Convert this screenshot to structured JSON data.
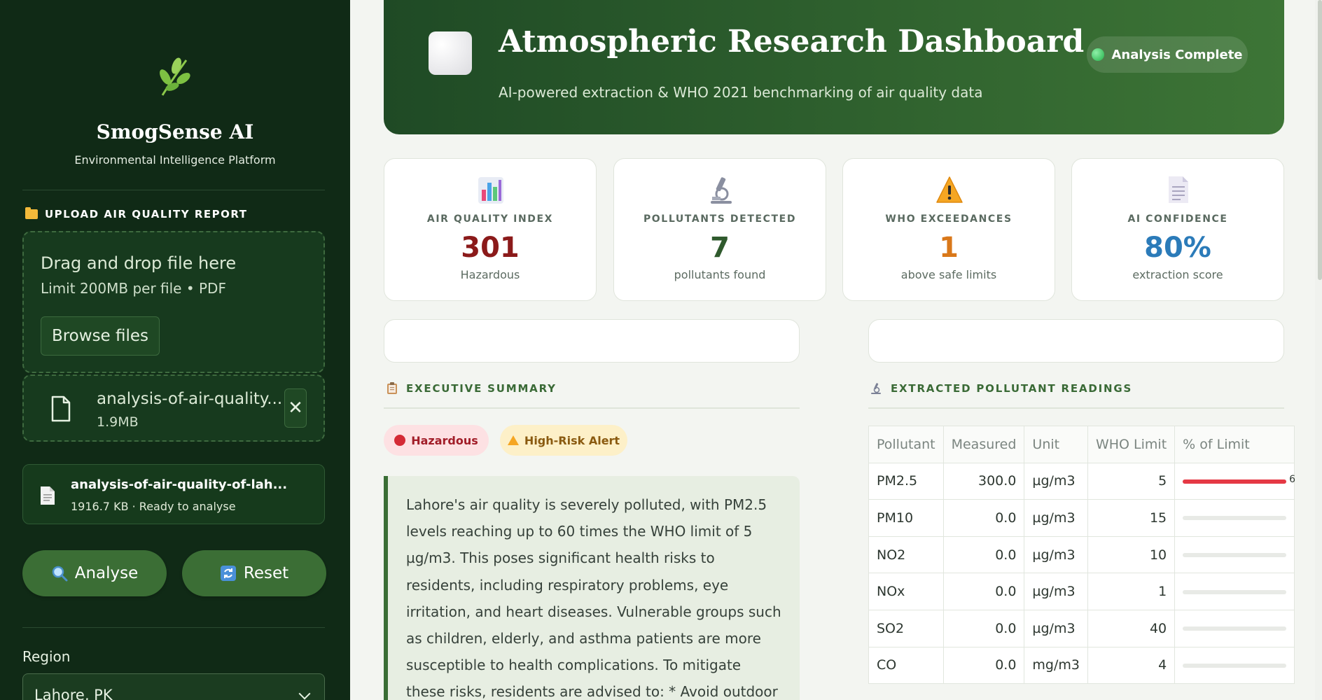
{
  "sidebar": {
    "brand_name": "SmogSense AI",
    "brand_tagline": "Environmental Intelligence Platform",
    "upload_heading": "UPLOAD AIR QUALITY REPORT",
    "dropzone": {
      "title": "Drag and drop file here",
      "limit": "Limit 200MB per file • PDF",
      "browse_label": "Browse files"
    },
    "uploaded_file": {
      "name": "analysis-of-air-quality...",
      "size": "1.9MB",
      "remove_glyph": "✕"
    },
    "ready_file": {
      "name": "analysis-of-air-quality-of-lah...",
      "meta": "1916.7 KB · Ready to analyse"
    },
    "analyse_label": "Analyse",
    "reset_label": "Reset",
    "region_label": "Region",
    "region_value": "Lahore, PK"
  },
  "header": {
    "title": "Atmospheric Research Dashboard",
    "subtitle": "AI-powered extraction & WHO 2021 benchmarking of air quality data",
    "status": "Analysis Complete"
  },
  "kpis": [
    {
      "label": "AIR QUALITY INDEX",
      "value": "301",
      "sub": "Hazardous",
      "color": "#8b1a1a",
      "icon": "bar-chart-icon"
    },
    {
      "label": "POLLUTANTS DETECTED",
      "value": "7",
      "sub": "pollutants found",
      "color": "#2f5a2d",
      "icon": "microscope-icon"
    },
    {
      "label": "WHO EXCEEDANCES",
      "value": "1",
      "sub": "above safe limits",
      "color": "#d9781a",
      "icon": "warning-icon"
    },
    {
      "label": "AI CONFIDENCE",
      "value": "80%",
      "sub": "extraction score",
      "color": "#2b7bb9",
      "icon": "document-icon"
    }
  ],
  "summary_section": {
    "heading": "EXECUTIVE SUMMARY",
    "badge_hazard": "Hazardous",
    "badge_alert": "High-Risk Alert",
    "text": "Lahore's air quality is severely polluted, with PM2.5 levels reaching up to 60 times the WHO limit of 5 µg/m3. This poses significant health risks to residents, including respiratory problems, eye irritation, and heart diseases. Vulnerable groups such as children, elderly, and asthma patients are more susceptible to health complications. To mitigate these risks, residents are advised to: * Avoid outdoor activities during peak pollution hours * Wear"
  },
  "readings_section": {
    "heading": "EXTRACTED POLLUTANT READINGS",
    "columns": [
      "Pollutant",
      "Measured",
      "Unit",
      "WHO Limit",
      "% of Limit"
    ],
    "rows": [
      {
        "pollutant": "PM2.5",
        "measured": "300.0",
        "unit": "µg/m3",
        "limit": "5",
        "pct": 100,
        "pct_text": "6"
      },
      {
        "pollutant": "PM10",
        "measured": "0.0",
        "unit": "µg/m3",
        "limit": "15",
        "pct": 0,
        "pct_text": ""
      },
      {
        "pollutant": "NO2",
        "measured": "0.0",
        "unit": "µg/m3",
        "limit": "10",
        "pct": 0,
        "pct_text": ""
      },
      {
        "pollutant": "NOx",
        "measured": "0.0",
        "unit": "µg/m3",
        "limit": "1",
        "pct": 0,
        "pct_text": ""
      },
      {
        "pollutant": "SO2",
        "measured": "0.0",
        "unit": "µg/m3",
        "limit": "40",
        "pct": 0,
        "pct_text": ""
      },
      {
        "pollutant": "CO",
        "measured": "0.0",
        "unit": "mg/m3",
        "limit": "4",
        "pct": 0,
        "pct_text": ""
      }
    ]
  },
  "colors": {
    "sidebar_bg": "#102a16",
    "accent_green": "#3b6e35",
    "alert_red": "#e53945"
  }
}
